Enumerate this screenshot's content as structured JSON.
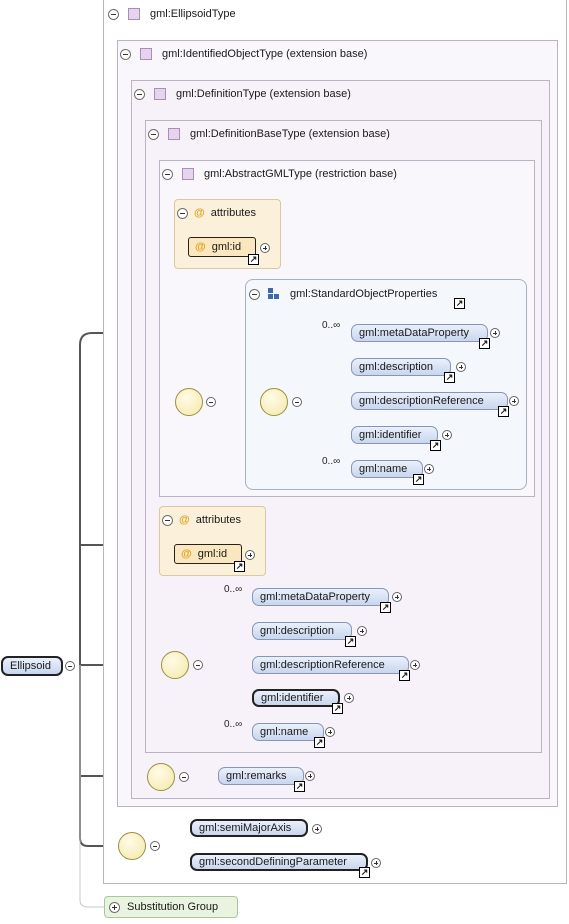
{
  "root_element": "Ellipsoid",
  "type_hierarchy": {
    "ellipsoid_type": "gml:EllipsoidType",
    "identified_object_type": "gml:IdentifiedObjectType (extension base)",
    "definition_type": "gml:DefinitionType (extension base)",
    "definition_base_type": "gml:DefinitionBaseType (extension base)",
    "abstract_gml_type": "gml:AbstractGMLType (restriction base)"
  },
  "inner_attributes": {
    "title": "attributes",
    "items": [
      "gml:id"
    ],
    "at_symbol": "@"
  },
  "standard_object_properties": {
    "title": "gml:StandardObjectProperties",
    "elements": [
      {
        "name": "gml:metaDataProperty",
        "occurrence": "0..∞"
      },
      {
        "name": "gml:description",
        "occurrence": ""
      },
      {
        "name": "gml:descriptionReference",
        "occurrence": ""
      },
      {
        "name": "gml:identifier",
        "occurrence": ""
      },
      {
        "name": "gml:name",
        "occurrence": "0..∞"
      }
    ]
  },
  "definition_base_attributes": {
    "title": "attributes",
    "items": [
      "gml:id"
    ]
  },
  "definition_base_sequence": [
    {
      "name": "gml:metaDataProperty",
      "occurrence": "0..∞"
    },
    {
      "name": "gml:description",
      "occurrence": ""
    },
    {
      "name": "gml:descriptionReference",
      "occurrence": ""
    },
    {
      "name": "gml:identifier",
      "occurrence": ""
    },
    {
      "name": "gml:name",
      "occurrence": "0..∞"
    }
  ],
  "identified_object_sequence": [
    {
      "name": "gml:remarks"
    }
  ],
  "ellipsoid_sequence": [
    {
      "name": "gml:semiMajorAxis"
    },
    {
      "name": "gml:secondDefiningParameter"
    }
  ],
  "substitution_group": "Substitution Group",
  "colors": {
    "complex_type": "#e6d4ee",
    "element": "#c9d6ee",
    "attribute_bg": "#fbf0da",
    "sequence": "#f3e8a8"
  }
}
